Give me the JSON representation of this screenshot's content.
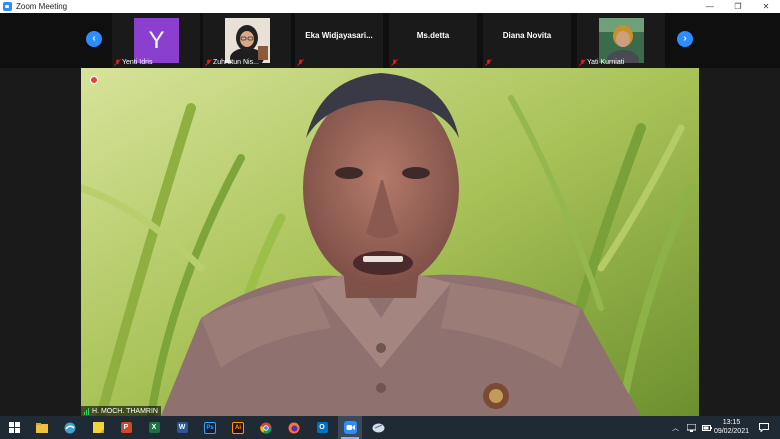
{
  "window": {
    "title": "Zoom Meeting",
    "controls": {
      "minimize": "—",
      "maximize": "❐",
      "close": "✕"
    }
  },
  "strip": {
    "prev_arrow": "‹",
    "next_arrow": "›",
    "participants": [
      {
        "name": "Yenti Idris",
        "type": "avatar",
        "initial": "Y",
        "muted": true
      },
      {
        "name": "Zuhrotun Nis...",
        "type": "video",
        "muted": true
      },
      {
        "name": "Eka  Widjayasari...",
        "type": "name",
        "muted": true
      },
      {
        "name": "Ms.detta",
        "type": "name",
        "muted": true
      },
      {
        "name": "Diana Novita",
        "type": "name",
        "muted": true
      },
      {
        "name": "Yati Kurniati",
        "type": "video",
        "muted": true
      }
    ]
  },
  "main": {
    "speaker_name": "H. MOCH. THAMRIN"
  },
  "taskbar": {
    "apps": [
      {
        "icon": "windows-start-icon"
      },
      {
        "icon": "file-explorer-icon"
      },
      {
        "icon": "edge-icon"
      },
      {
        "icon": "sticky-notes-icon"
      },
      {
        "icon": "powerpoint-icon",
        "letter": "P"
      },
      {
        "icon": "excel-icon",
        "letter": "X"
      },
      {
        "icon": "word-icon",
        "letter": "W"
      },
      {
        "icon": "photoshop-icon",
        "letter": "Ps"
      },
      {
        "icon": "illustrator-icon",
        "letter": "Ai"
      },
      {
        "icon": "chrome-icon"
      },
      {
        "icon": "firefox-icon"
      },
      {
        "icon": "outlook-icon",
        "letter": "O"
      },
      {
        "icon": "zoom-icon"
      },
      {
        "icon": "app-icon"
      }
    ],
    "time": "13:15",
    "date": "09/02/2021"
  },
  "colors": {
    "zoom_blue": "#2d8cff",
    "avatar_purple": "#8a3fcf",
    "taskbar": "#202a35",
    "muted_red": "#e02020"
  }
}
